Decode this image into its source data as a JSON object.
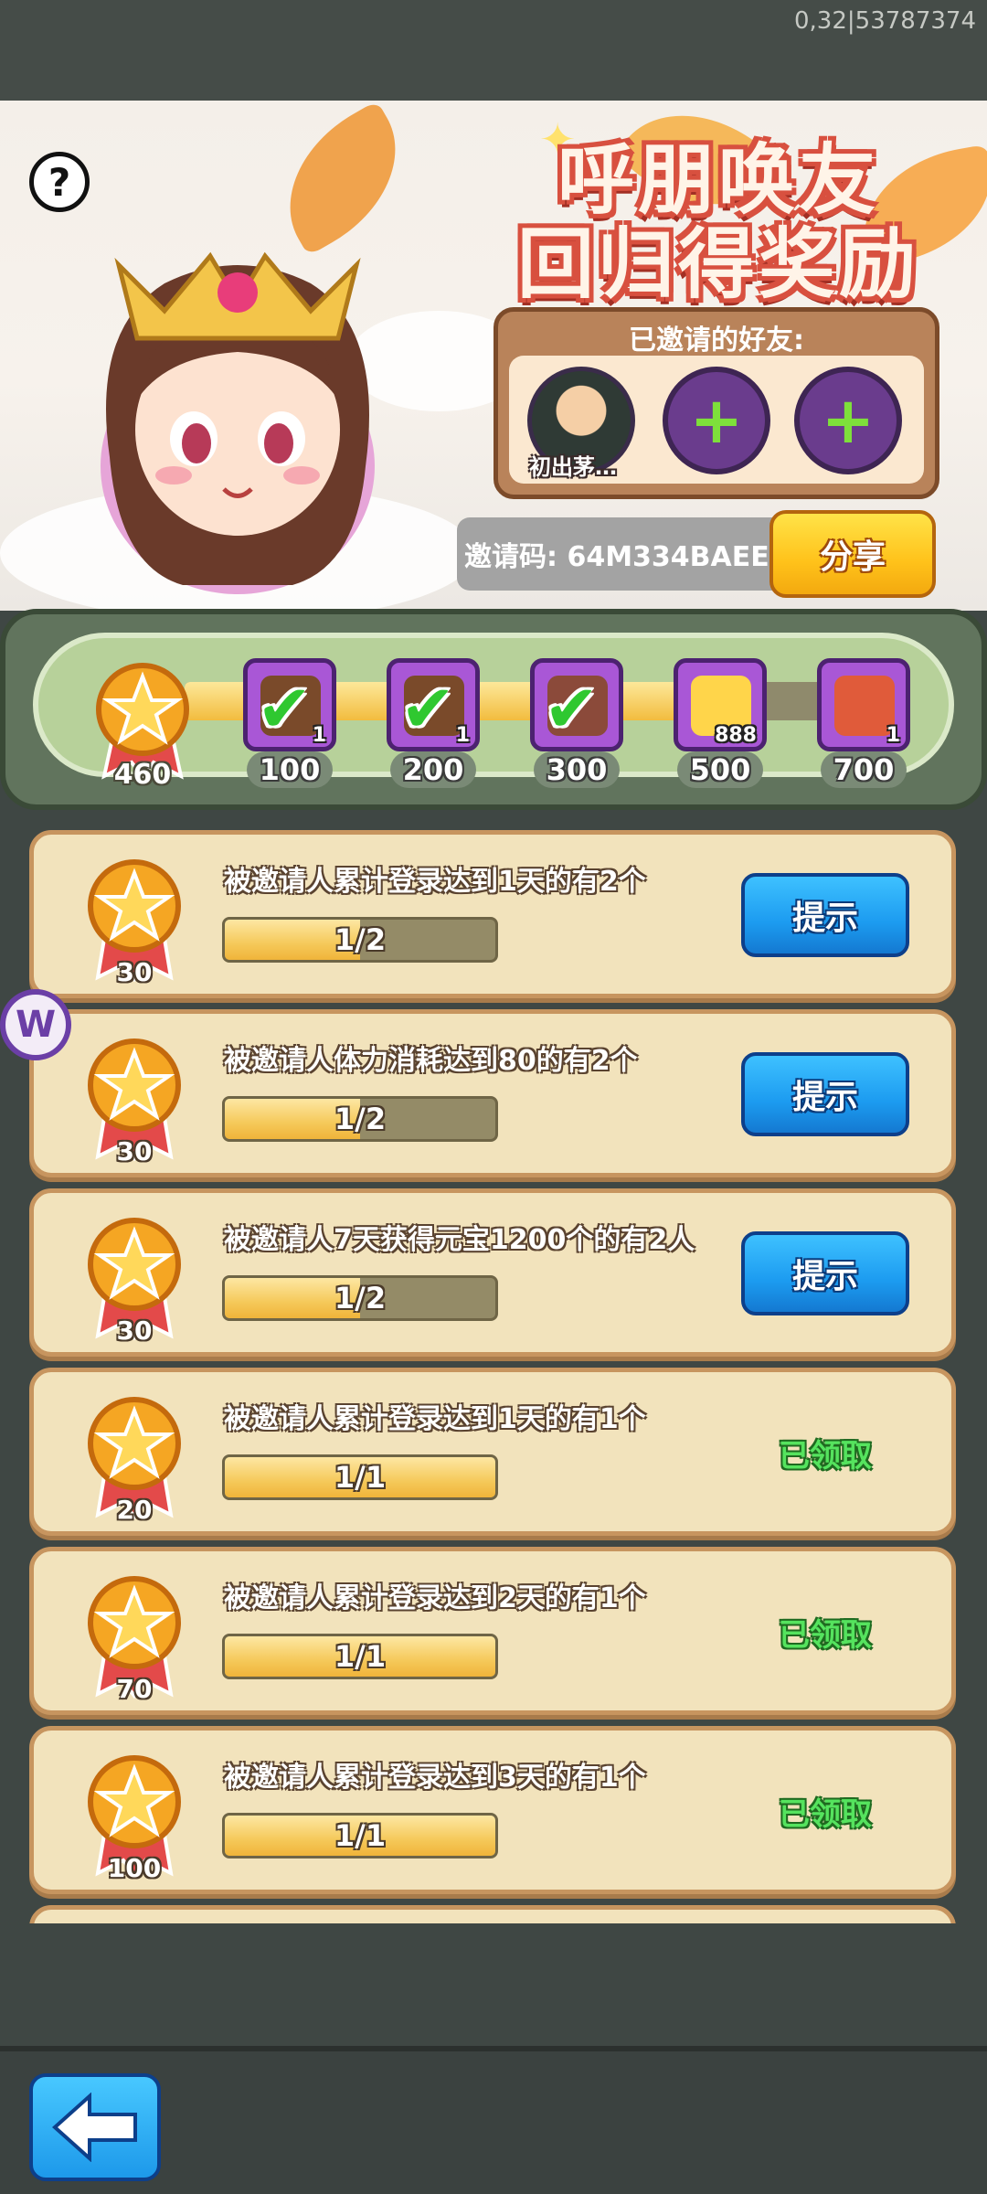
{
  "status_debug": "0,32|53787374",
  "banner": {
    "title_line1": "呼朋唤友",
    "title_line2": "回归得奖励",
    "help_label": "?",
    "invited_title": "已邀请的好友:",
    "friend_name": "初出茅…",
    "add_symbol": "+",
    "invite_code_text": "邀请码: 64M334BAEE",
    "share_label": "分享"
  },
  "progress": {
    "total": "460",
    "fill_fraction": 0.77,
    "milestones": [
      {
        "value": "100",
        "count": "1",
        "icon": "chest-icon",
        "claimed": true
      },
      {
        "value": "200",
        "count": "1",
        "icon": "chest-icon",
        "claimed": true
      },
      {
        "value": "300",
        "count": "",
        "icon": "hero-portrait-icon",
        "claimed": true
      },
      {
        "value": "500",
        "count": "888",
        "icon": "gold-ingot-icon",
        "claimed": false
      },
      {
        "value": "700",
        "count": "1",
        "icon": "armor-icon",
        "claimed": false
      }
    ]
  },
  "tasks": [
    {
      "reward": "30",
      "desc": "被邀请人累计登录达到1天的有2个",
      "progress": "1/2",
      "fraction": 0.5,
      "action": "提示"
    },
    {
      "reward": "30",
      "desc": "被邀请人体力消耗达到80的有2个",
      "progress": "1/2",
      "fraction": 0.5,
      "action": "提示"
    },
    {
      "reward": "30",
      "desc": "被邀请人7天获得元宝1200个的有2人",
      "progress": "1/2",
      "fraction": 0.5,
      "action": "提示"
    },
    {
      "reward": "20",
      "desc": "被邀请人累计登录达到1天的有1个",
      "progress": "1/1",
      "fraction": 1,
      "status": "已领取"
    },
    {
      "reward": "70",
      "desc": "被邀请人累计登录达到2天的有1个",
      "progress": "1/1",
      "fraction": 1,
      "status": "已领取"
    },
    {
      "reward": "100",
      "desc": "被邀请人累计登录达到3天的有1个",
      "progress": "1/1",
      "fraction": 1,
      "status": "已领取"
    }
  ],
  "colors": {
    "accent_blue": "#1c9bf0",
    "accent_yellow": "#ffc21a",
    "claimed_green": "#55e35e"
  }
}
